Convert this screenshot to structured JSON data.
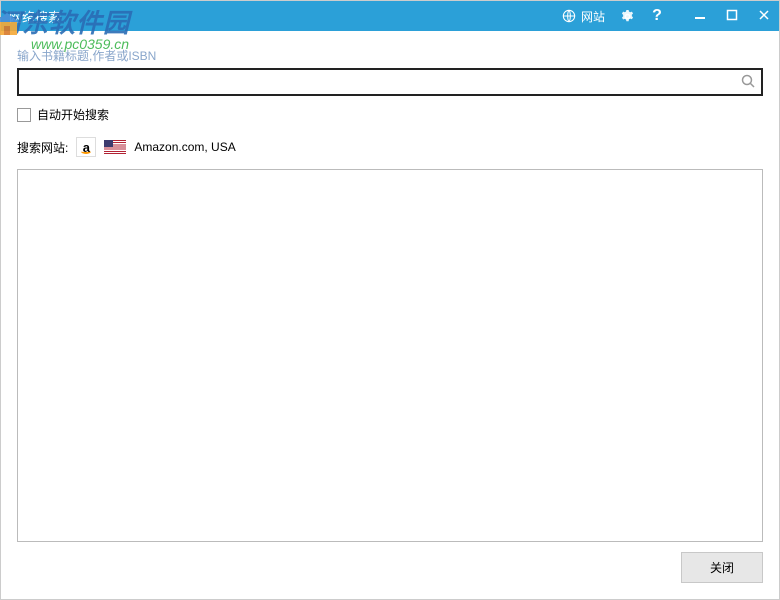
{
  "titlebar": {
    "title": "网络搜索",
    "website_label": "网站"
  },
  "watermark": {
    "main": "河东软件园",
    "sub": "www.pc0359.cn"
  },
  "search": {
    "hint": "输入书籍标题,作者或ISBN",
    "value": ""
  },
  "auto_search": {
    "label": "自动开始搜索",
    "checked": false
  },
  "site": {
    "label": "搜索网站:",
    "name": "Amazon.com, USA",
    "amazon_letter": "a"
  },
  "footer": {
    "close_label": "关闭"
  }
}
